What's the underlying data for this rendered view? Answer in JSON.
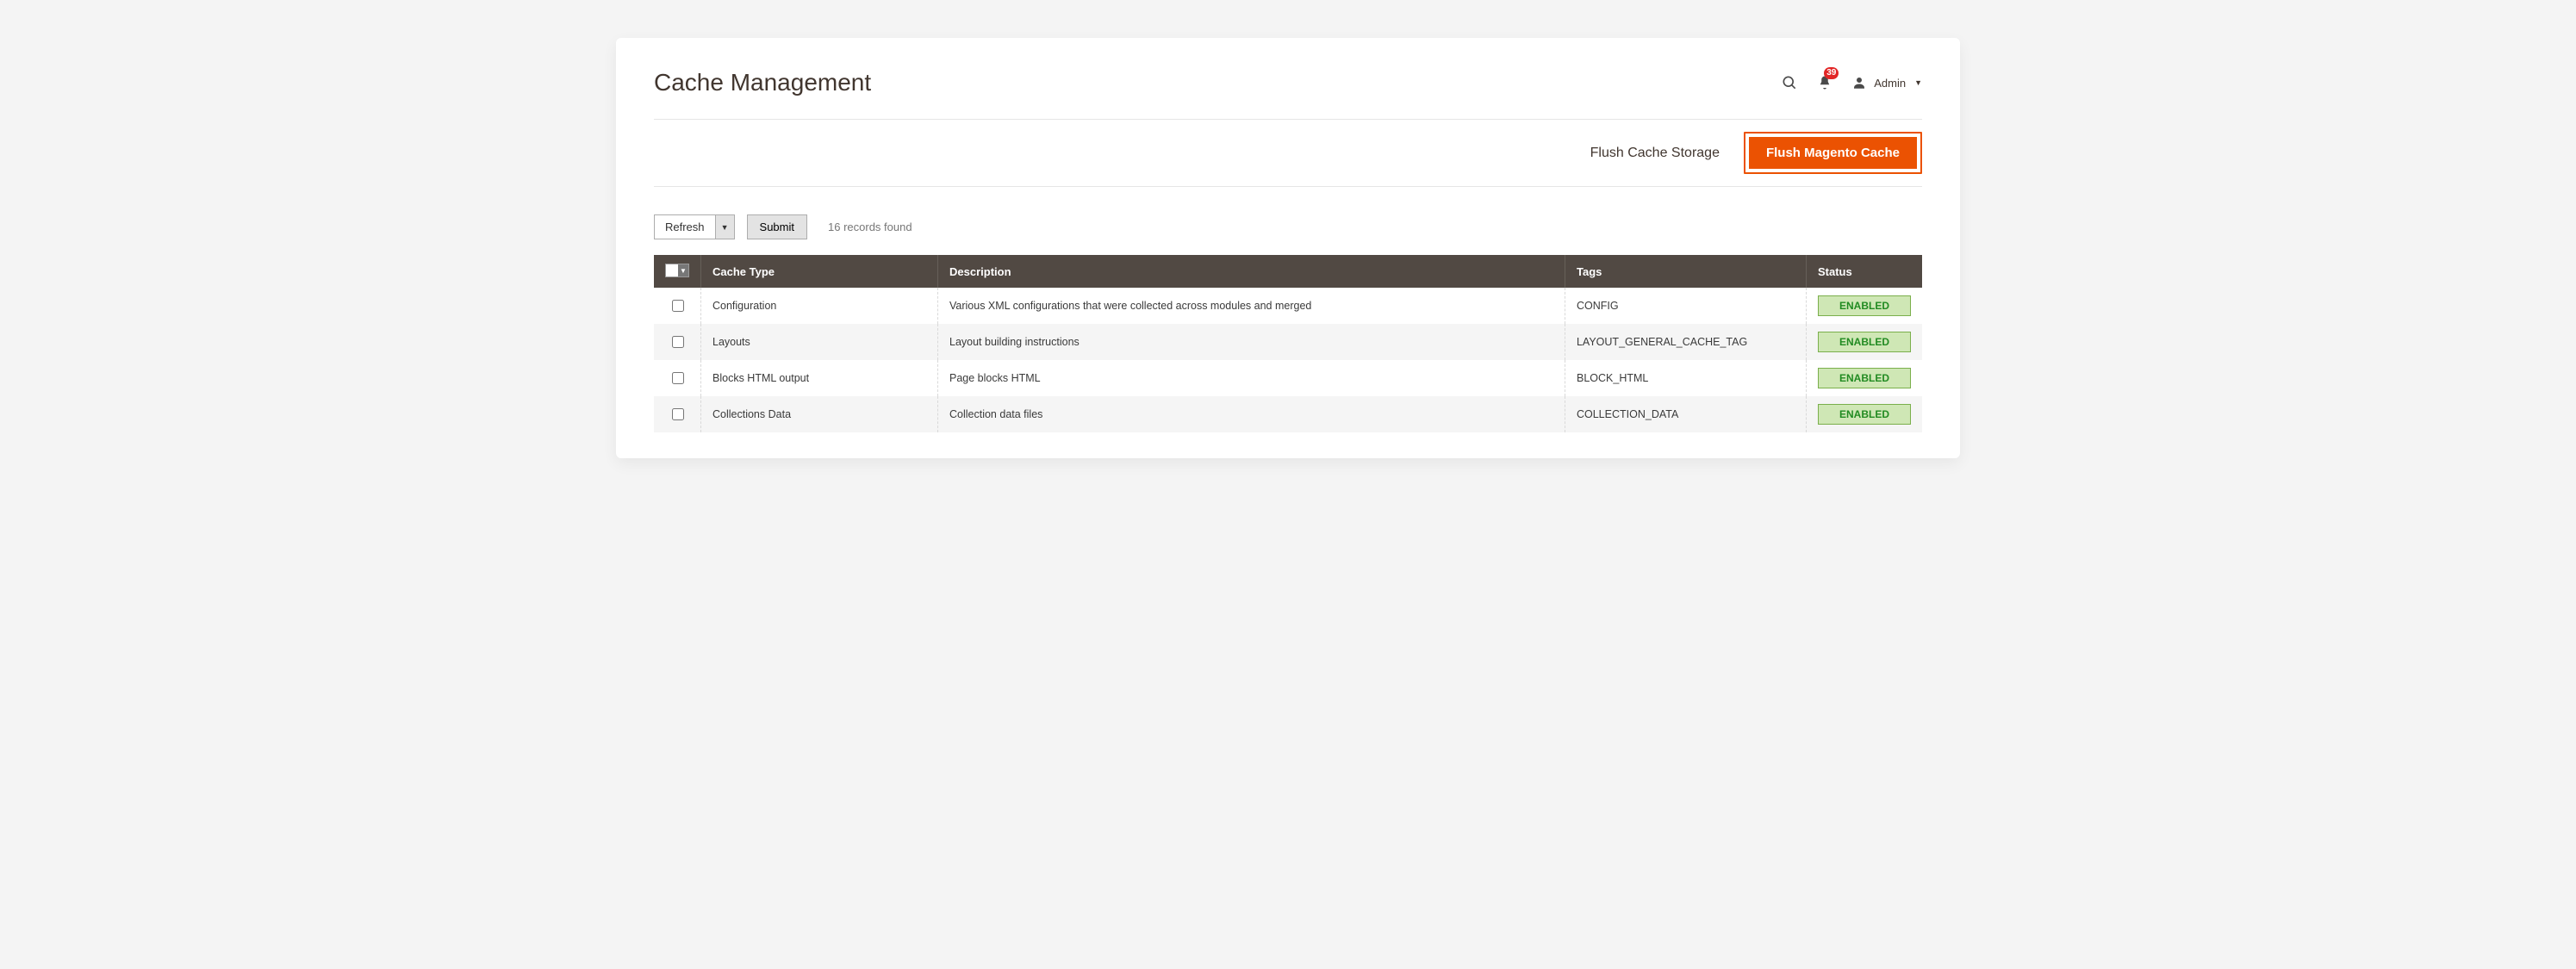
{
  "header": {
    "title": "Cache Management",
    "notif_count": "39",
    "user_label": "Admin"
  },
  "actions": {
    "flush_storage": "Flush Cache Storage",
    "flush_magento": "Flush Magento Cache"
  },
  "controls": {
    "refresh_label": "Refresh",
    "submit_label": "Submit",
    "records_found": "16 records found"
  },
  "table": {
    "headers": {
      "type": "Cache Type",
      "description": "Description",
      "tags": "Tags",
      "status": "Status"
    },
    "rows": [
      {
        "type": "Configuration",
        "description": "Various XML configurations that were collected across modules and merged",
        "tags": "CONFIG",
        "status": "ENABLED"
      },
      {
        "type": "Layouts",
        "description": "Layout building instructions",
        "tags": "LAYOUT_GENERAL_CACHE_TAG",
        "status": "ENABLED"
      },
      {
        "type": "Blocks HTML output",
        "description": "Page blocks HTML",
        "tags": "BLOCK_HTML",
        "status": "ENABLED"
      },
      {
        "type": "Collections Data",
        "description": "Collection data files",
        "tags": "COLLECTION_DATA",
        "status": "ENABLED"
      }
    ]
  }
}
